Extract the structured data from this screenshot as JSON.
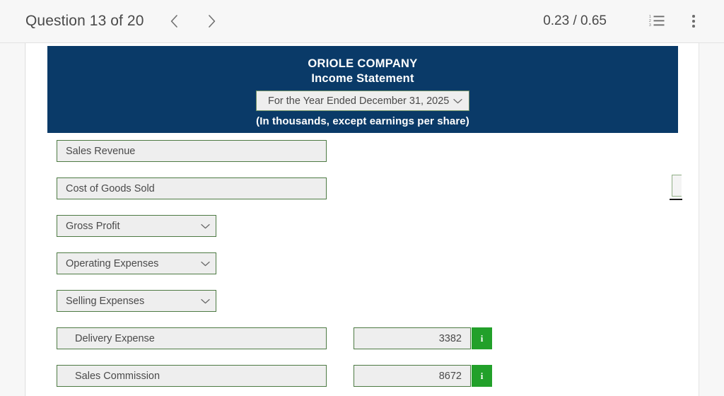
{
  "topbar": {
    "question_label": "Question 13 of 20",
    "prev_icon": "chevron-left-icon",
    "next_icon": "chevron-right-icon",
    "score": "0.23 / 0.65",
    "list_icon": "numbered-list-icon",
    "menu_icon": "vertical-dots-menu-icon"
  },
  "statement": {
    "company": "ORIOLE COMPANY",
    "title": "Income Statement",
    "period_selected": "For the Year Ended December 31, 2025",
    "units_note": "(In thousands, except earnings per share)",
    "header_bg": "#0a3a68"
  },
  "colors": {
    "header_navy": "#0a3a68",
    "field_border_green": "#4d7a43",
    "field_fill": "#eeeeee",
    "info_green": "#22a02a",
    "page_bg": "#f7f7f7",
    "sheet_bg": "#ffffff"
  },
  "currency_symbol": "$",
  "info_glyph": "i",
  "rows": [
    {
      "label": "Sales Revenue",
      "type": "input",
      "width": "wide",
      "indent": false,
      "amount": null,
      "has_dollar": false,
      "has_info": false
    },
    {
      "label": "Cost of Goods Sold",
      "type": "input",
      "width": "wide",
      "indent": false,
      "amount": null,
      "has_dollar": false,
      "has_info": false
    },
    {
      "label": "Gross Profit",
      "type": "select",
      "width": "narrow",
      "indent": false,
      "amount": null,
      "has_dollar": false,
      "has_info": false
    },
    {
      "label": "Operating Expenses",
      "type": "select",
      "width": "narrow",
      "indent": false,
      "amount": null,
      "has_dollar": false,
      "has_info": false
    },
    {
      "label": "Selling Expenses",
      "type": "select",
      "width": "narrow",
      "indent": false,
      "amount": null,
      "has_dollar": false,
      "has_info": false
    },
    {
      "label": "Delivery Expense",
      "type": "input",
      "width": "wide",
      "indent": true,
      "amount": "3382",
      "has_dollar": true,
      "has_info": true
    },
    {
      "label": "Sales Commission",
      "type": "input",
      "width": "wide",
      "indent": true,
      "amount": "8672",
      "has_dollar": false,
      "has_info": true
    }
  ]
}
